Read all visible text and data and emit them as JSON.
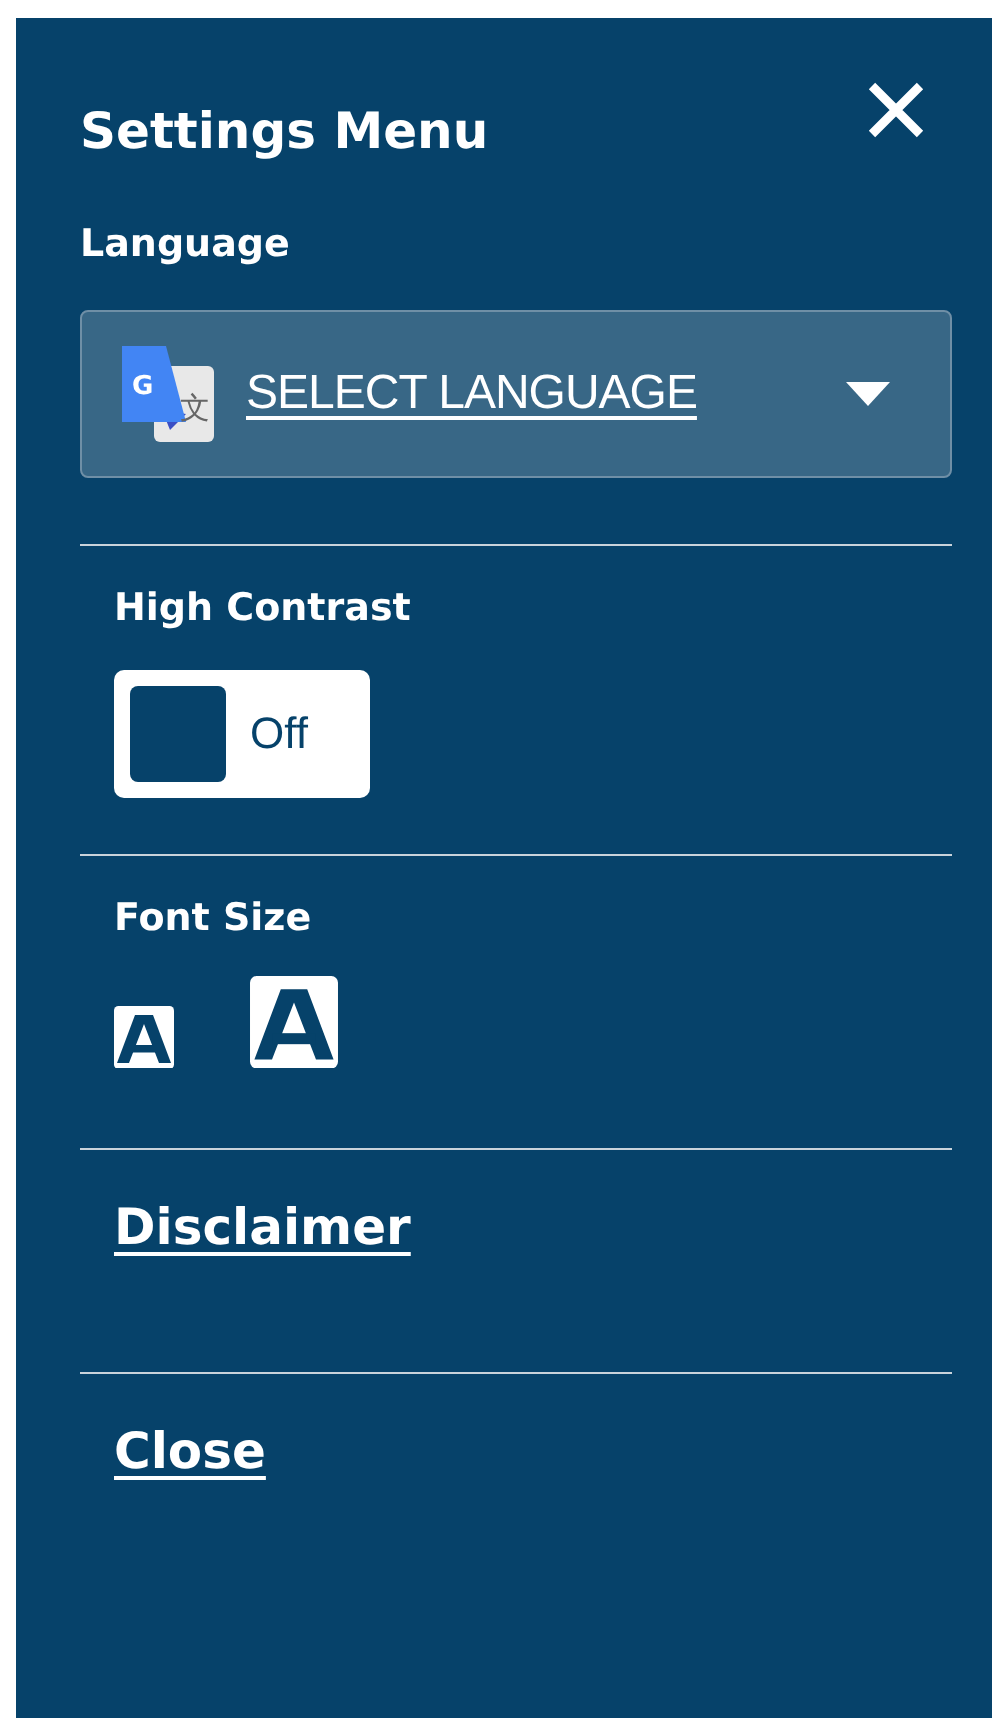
{
  "title": "Settings Menu",
  "language": {
    "label": "Language",
    "select_text": "SELECT LANGUAGE",
    "icon_texts": [
      "G",
      "文"
    ]
  },
  "high_contrast": {
    "label": "High Contrast",
    "on": false,
    "state_text": "Off"
  },
  "font_size": {
    "label": "Font Size"
  },
  "links": [
    "Disclaimer",
    "Close"
  ]
}
